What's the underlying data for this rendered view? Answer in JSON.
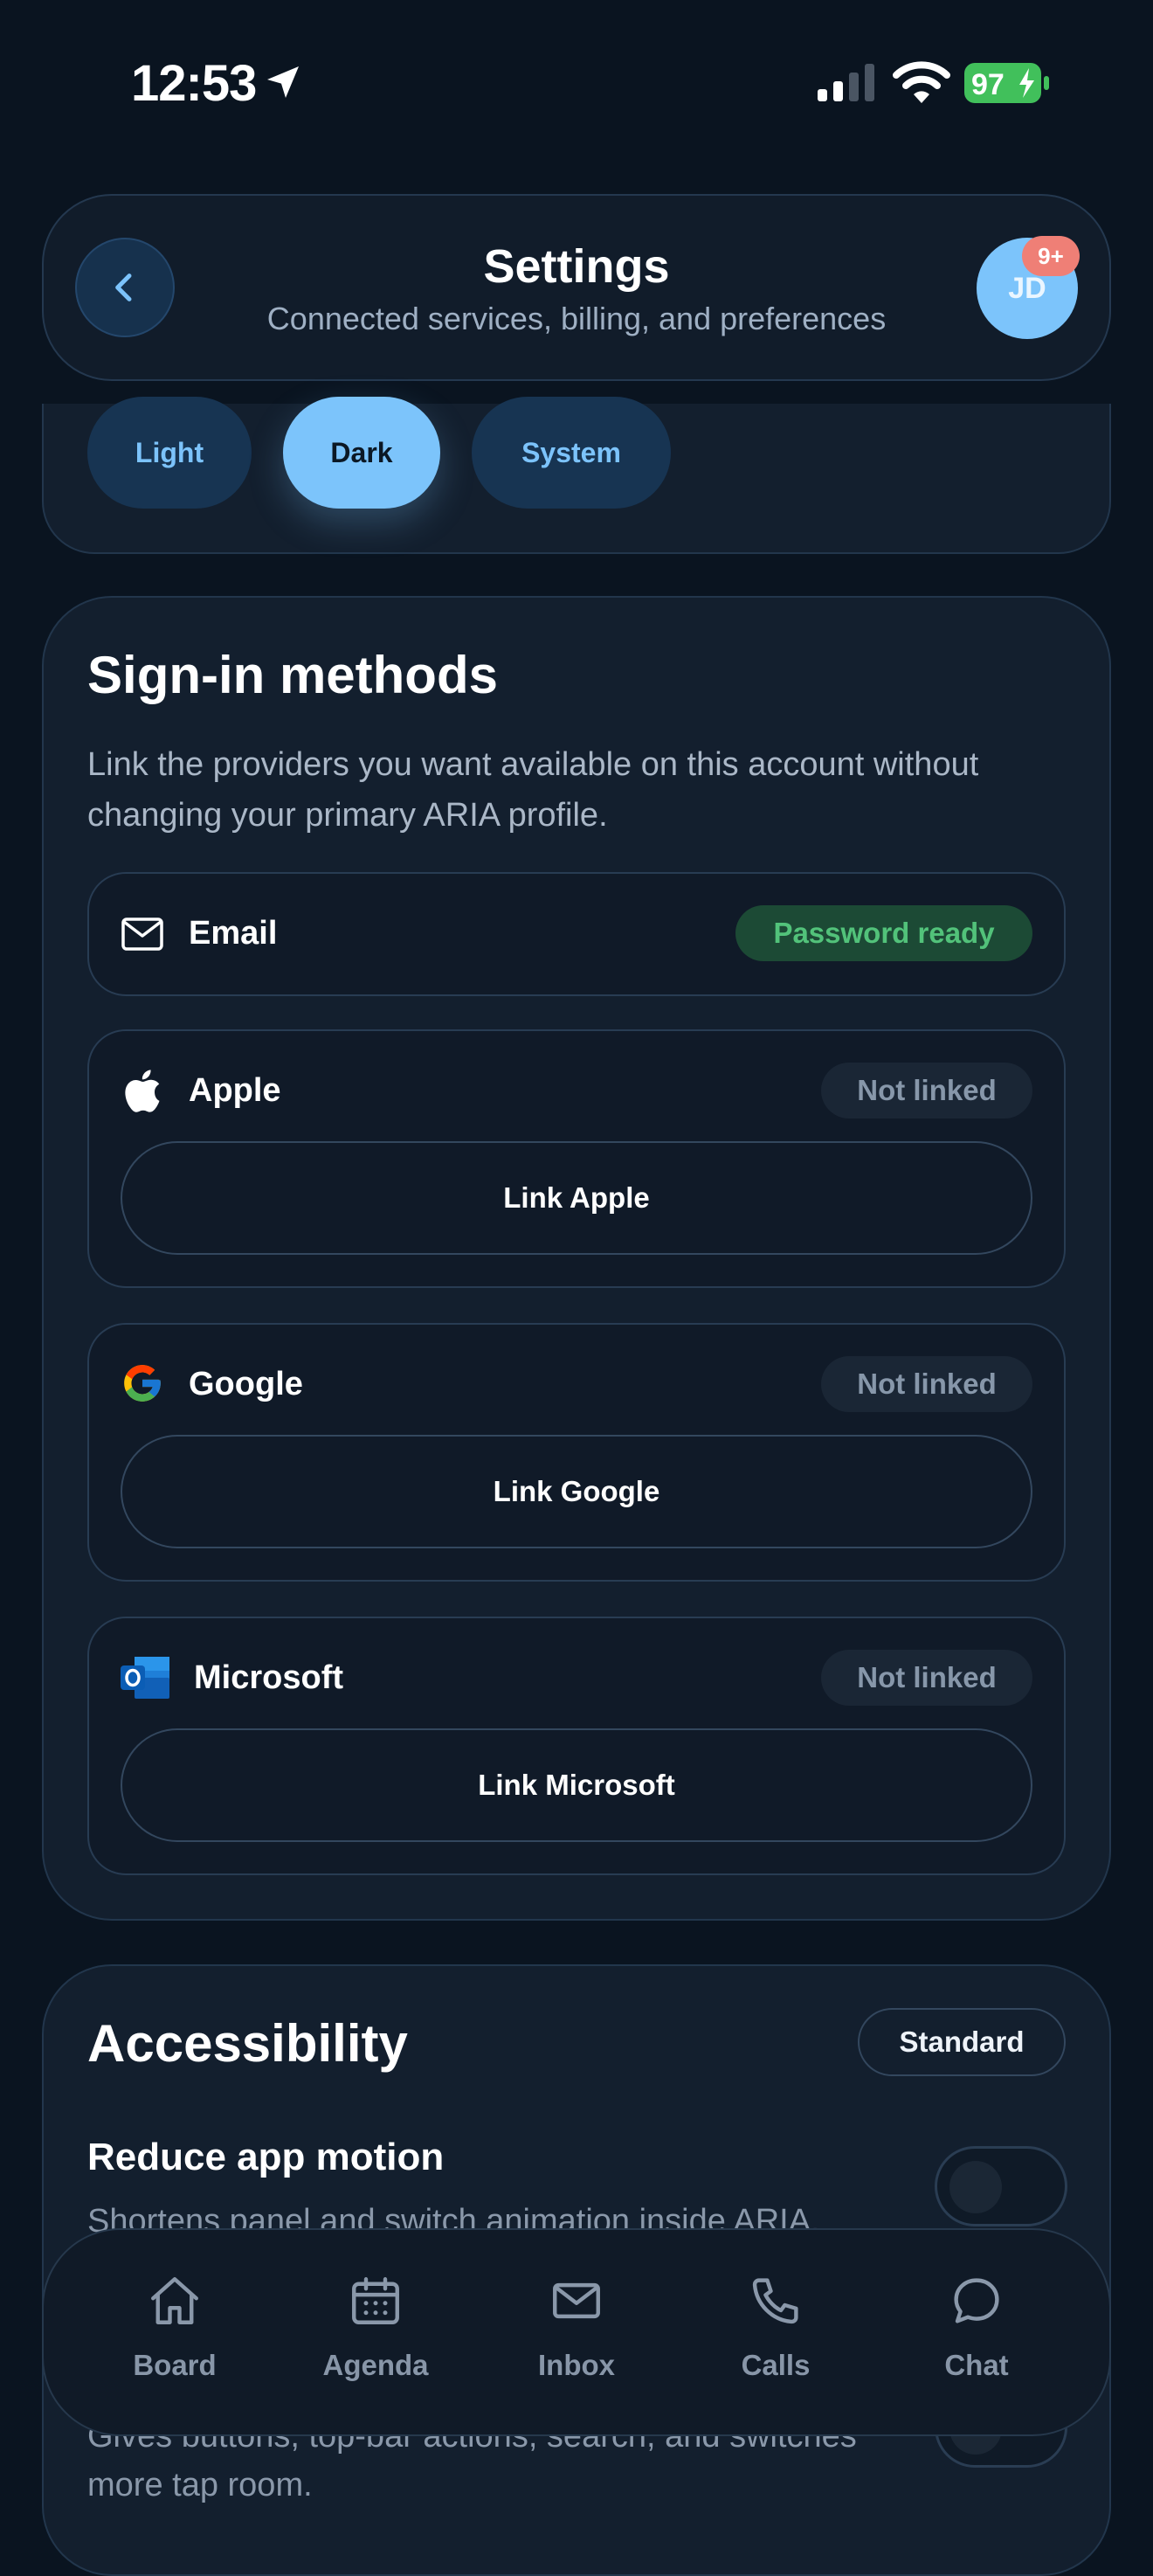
{
  "status_bar": {
    "time": "12:53",
    "battery": "97"
  },
  "header": {
    "title": "Settings",
    "subtitle": "Connected services, billing, and preferences",
    "avatar_initials": "JD",
    "notification_badge": "9+"
  },
  "theme": {
    "options": [
      {
        "label": "Light",
        "selected": false
      },
      {
        "label": "Dark",
        "selected": true
      },
      {
        "label": "System",
        "selected": false
      }
    ]
  },
  "signin": {
    "title": "Sign-in methods",
    "description": "Link the providers you want available on this account without changing your primary ARIA profile.",
    "providers": [
      {
        "name": "Email",
        "icon": "mail-icon",
        "status": "Password ready"
      },
      {
        "name": "Apple",
        "icon": "apple-icon",
        "status": "Not linked",
        "action": "Link Apple"
      },
      {
        "name": "Google",
        "icon": "google-icon",
        "status": "Not linked",
        "action": "Link Google"
      },
      {
        "name": "Microsoft",
        "icon": "outlook-icon",
        "status": "Not linked",
        "action": "Link Microsoft"
      }
    ]
  },
  "accessibility": {
    "title": "Accessibility",
    "badge": "Standard",
    "settings": [
      {
        "title": "Reduce app motion",
        "description": "Shortens panel and switch animation inside ARIA.",
        "enabled": false
      },
      {
        "title": "",
        "description": "Gives buttons, top-bar actions, search, and switches more tap room.",
        "enabled": false
      }
    ]
  },
  "tabbar": {
    "tabs": [
      {
        "label": "Board",
        "icon": "home-icon"
      },
      {
        "label": "Agenda",
        "icon": "calendar-icon"
      },
      {
        "label": "Inbox",
        "icon": "mail-icon"
      },
      {
        "label": "Calls",
        "icon": "phone-icon"
      },
      {
        "label": "Chat",
        "icon": "chat-bubble-icon"
      }
    ]
  },
  "colors": {
    "background": "#0a1420",
    "card": "#131f2e",
    "accent": "#7cc4fb",
    "success": "#52c27a",
    "badge": "#ef7f76"
  }
}
